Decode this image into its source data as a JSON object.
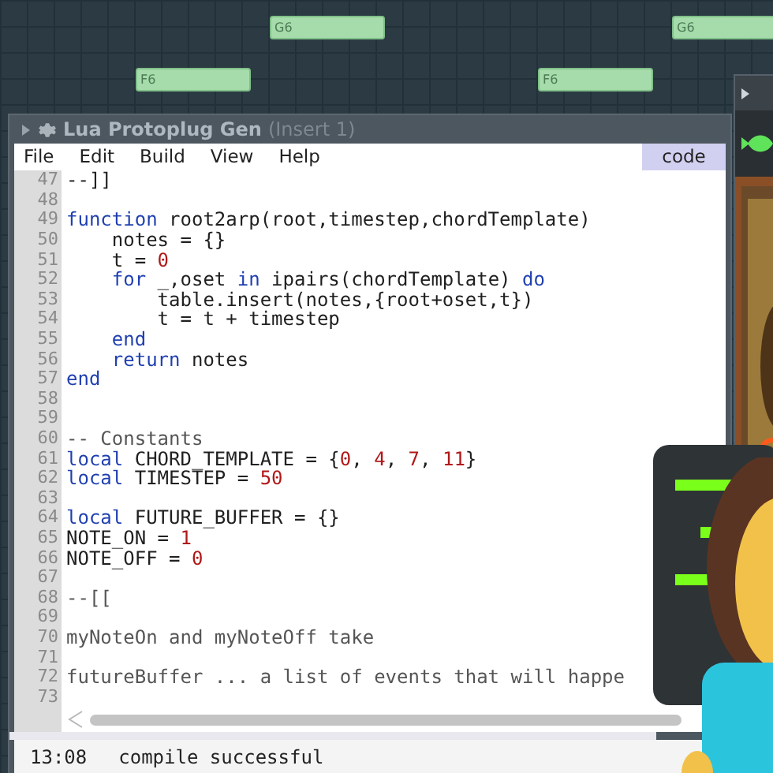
{
  "piano_roll": {
    "notes": [
      {
        "label": "G6"
      },
      {
        "label": "G6"
      },
      {
        "label": "F6"
      },
      {
        "label": "F6"
      }
    ]
  },
  "window": {
    "title": "Lua Protoplug Gen",
    "subtitle": "(Insert 1)"
  },
  "menu": [
    "File",
    "Edit",
    "Build",
    "View",
    "Help"
  ],
  "tabs": [
    {
      "label": "code",
      "selected": true
    }
  ],
  "editor": {
    "lines": [
      {
        "number": "47",
        "tokens": [
          {
            "text": "--]]",
            "kind": "plain"
          }
        ]
      },
      {
        "number": "48"
      },
      {
        "number": "49",
        "tokens": [
          {
            "text": "function",
            "kind": "keyword"
          },
          {
            "text": " root2arp(root,timestep,chordTemplate)",
            "kind": "plain"
          }
        ]
      },
      {
        "number": "50",
        "tokens": [
          {
            "text": "    notes = {}",
            "kind": "plain"
          }
        ]
      },
      {
        "number": "51",
        "tokens": [
          {
            "text": "    t = ",
            "kind": "plain"
          },
          {
            "text": "0",
            "kind": "number"
          }
        ]
      },
      {
        "number": "52",
        "tokens": [
          {
            "text": "    for",
            "kind": "keyword"
          },
          {
            "text": " _,oset ",
            "kind": "plain"
          },
          {
            "text": "in",
            "kind": "keyword"
          },
          {
            "text": " ipairs(chordTemplate) ",
            "kind": "plain"
          },
          {
            "text": "do",
            "kind": "keyword"
          }
        ]
      },
      {
        "number": "53",
        "tokens": [
          {
            "text": "        table.insert(notes,{root+oset,t})",
            "kind": "plain"
          }
        ]
      },
      {
        "number": "54",
        "tokens": [
          {
            "text": "        t = t + timestep",
            "kind": "plain"
          }
        ]
      },
      {
        "number": "55",
        "tokens": [
          {
            "text": "    end",
            "kind": "keyword"
          }
        ]
      },
      {
        "number": "56",
        "tokens": [
          {
            "text": "    return",
            "kind": "keyword"
          },
          {
            "text": " notes",
            "kind": "plain"
          }
        ]
      },
      {
        "number": "57",
        "tokens": [
          {
            "text": "end",
            "kind": "keyword"
          }
        ]
      },
      {
        "number": "58"
      },
      {
        "number": "59"
      },
      {
        "number": "60",
        "tokens": [
          {
            "text": "-- Constants",
            "kind": "comment"
          }
        ]
      },
      {
        "number": "61",
        "tokens": [
          {
            "text": "local",
            "kind": "keyword"
          },
          {
            "text": " CHORD_TEMPLATE = {",
            "kind": "plain"
          },
          {
            "text": "0",
            "kind": "number"
          },
          {
            "text": ", ",
            "kind": "plain"
          },
          {
            "text": "4",
            "kind": "number"
          },
          {
            "text": ", ",
            "kind": "plain"
          },
          {
            "text": "7",
            "kind": "number"
          },
          {
            "text": ", ",
            "kind": "plain"
          },
          {
            "text": "11",
            "kind": "number"
          },
          {
            "text": "}",
            "kind": "plain"
          }
        ]
      },
      {
        "number": "62",
        "tokens": [
          {
            "text": "local",
            "kind": "keyword"
          },
          {
            "text": " TIMESTEP = ",
            "kind": "plain"
          },
          {
            "text": "50",
            "kind": "number"
          }
        ]
      },
      {
        "number": "63"
      },
      {
        "number": "64",
        "tokens": [
          {
            "text": "local",
            "kind": "keyword"
          },
          {
            "text": " FUTURE_BUFFER = {}",
            "kind": "plain"
          }
        ]
      },
      {
        "number": "65",
        "tokens": [
          {
            "text": "NOTE_ON = ",
            "kind": "plain"
          },
          {
            "text": "1",
            "kind": "number"
          }
        ]
      },
      {
        "number": "66",
        "tokens": [
          {
            "text": "NOTE_OFF = ",
            "kind": "plain"
          },
          {
            "text": "0",
            "kind": "number"
          }
        ]
      },
      {
        "number": "67"
      },
      {
        "number": "68",
        "tokens": [
          {
            "text": "--[[",
            "kind": "comment"
          }
        ]
      },
      {
        "number": "69"
      },
      {
        "number": "70",
        "tokens": [
          {
            "text": "myNoteOn and myNoteOff take",
            "kind": "comment"
          }
        ]
      },
      {
        "number": "71"
      },
      {
        "number": "72",
        "tokens": [
          {
            "text": "futureBuffer ... a list of events that will happe",
            "kind": "comment"
          }
        ]
      },
      {
        "number": "73"
      }
    ]
  },
  "log": [
    {
      "time": "13:08",
      "message": "compile successful"
    }
  ]
}
